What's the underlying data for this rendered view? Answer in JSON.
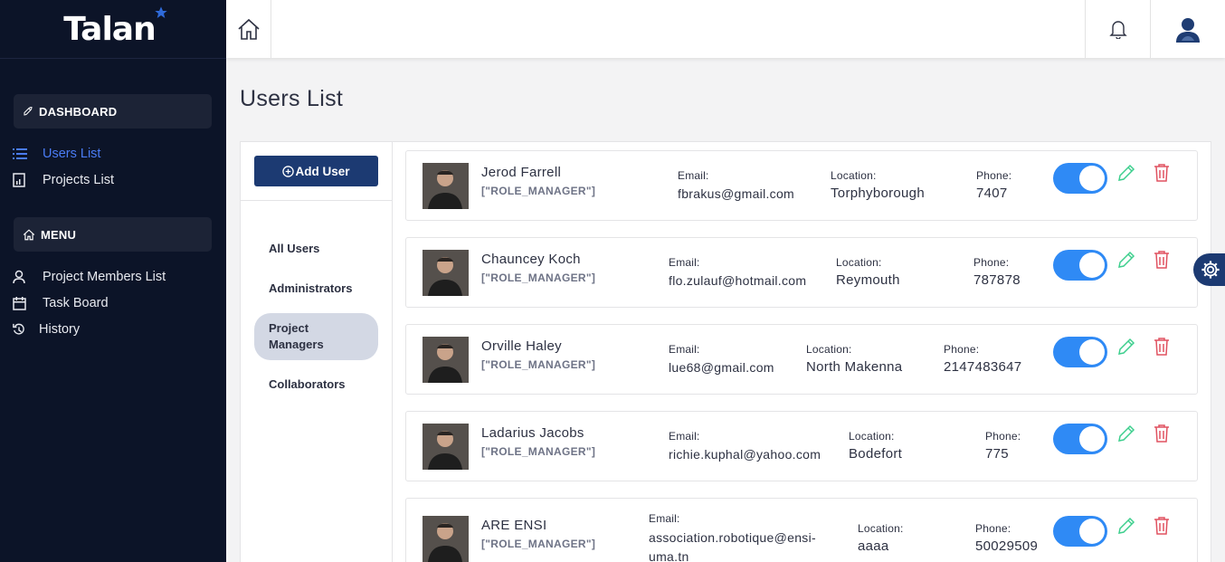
{
  "brand": {
    "name": "Talan"
  },
  "sidebar": {
    "dashboard_label": "DASHBOARD",
    "menu_label": "MENU",
    "items": [
      {
        "label": "Users List",
        "icon": "list-icon",
        "active": true
      },
      {
        "label": "Projects List",
        "icon": "report-icon"
      }
    ],
    "menu_items": [
      {
        "label": "Project Members List",
        "icon": "members-icon"
      },
      {
        "label": "Task Board",
        "icon": "calendar-icon"
      },
      {
        "label": "History",
        "icon": "history-icon"
      }
    ]
  },
  "page": {
    "title": "Users List"
  },
  "filters": {
    "add_user": "Add User",
    "options": [
      "All Users",
      "Administrators",
      "Project Managers",
      "Collaborators"
    ],
    "selected": "Project Managers"
  },
  "labels": {
    "email": "Email:",
    "location": "Location:",
    "phone": "Phone:"
  },
  "users": [
    {
      "name": "Jerod Farrell",
      "role": "[\"ROLE_MANAGER\"]",
      "email": "fbrakus@gmail.com",
      "location": "Torphyborough",
      "phone": "7407",
      "enabled": true
    },
    {
      "name": "Chauncey Koch",
      "role": "[\"ROLE_MANAGER\"]",
      "email": "flo.zulauf@hotmail.com",
      "location": "Reymouth",
      "phone": "787878",
      "enabled": true
    },
    {
      "name": "Orville Haley",
      "role": "[\"ROLE_MANAGER\"]",
      "email": "lue68@gmail.com",
      "location": "North Makenna",
      "phone": "2147483647",
      "enabled": true
    },
    {
      "name": "Ladarius Jacobs",
      "role": "[\"ROLE_MANAGER\"]",
      "email": "richie.kuphal@yahoo.com",
      "location": "Bodefort",
      "phone": "775",
      "enabled": true
    },
    {
      "name": "ARE ENSI",
      "role": "[\"ROLE_MANAGER\"]",
      "email_line1": "association.robotique@ensi-",
      "email_line2": "uma.tn",
      "location": "aaaa",
      "phone": "50029509",
      "enabled": true
    }
  ],
  "colors": {
    "sidebar_bg": "#0c1428",
    "accent": "#4a7cf5",
    "primary_button": "#1c3a72",
    "toggle_on": "#2f8af5",
    "edit": "#3ecf8e",
    "delete": "#e05260"
  }
}
